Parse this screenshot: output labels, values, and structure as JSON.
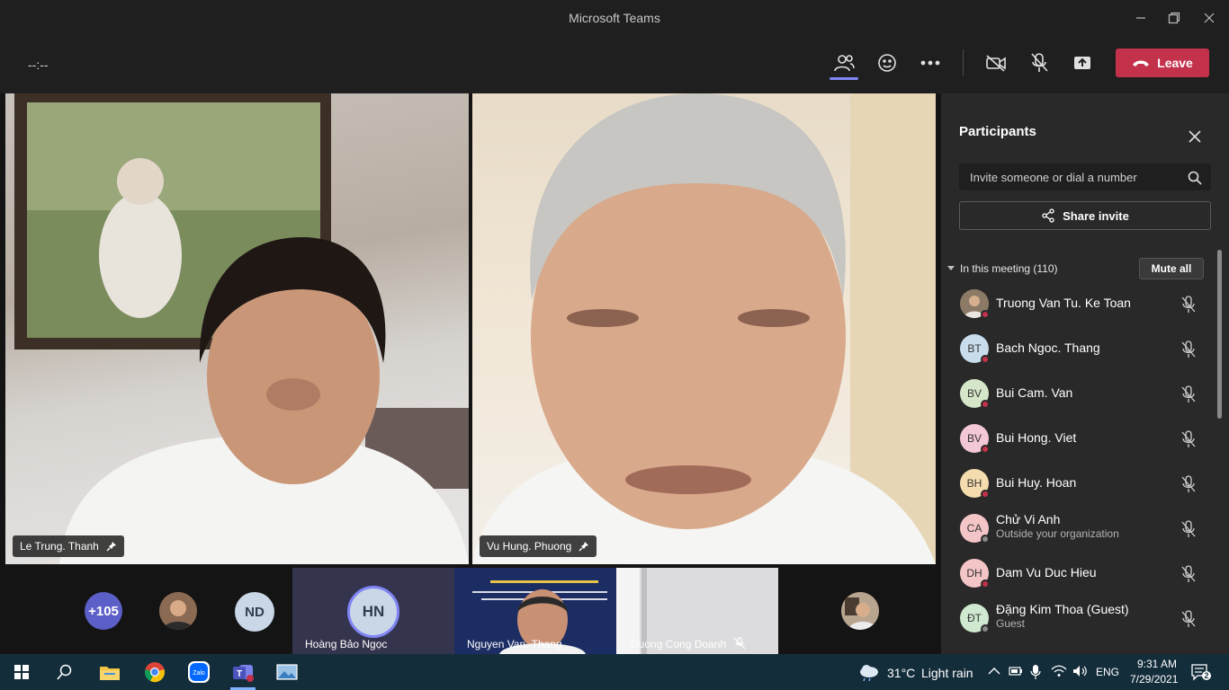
{
  "window": {
    "title": "Microsoft Teams"
  },
  "toolbar": {
    "timer": "--:--",
    "leave_label": "Leave"
  },
  "videos": [
    {
      "name": "Le Trung. Thanh"
    },
    {
      "name": "Vu Hung. Phuong"
    }
  ],
  "strip": {
    "overflow_count": "+105",
    "nd_initials": "ND",
    "tiles": [
      {
        "name": "Hoàng Bảo Ngọc",
        "initials": "HN"
      },
      {
        "name": "Nguyen Van. Thang"
      },
      {
        "name": "Duong Cong Doanh"
      }
    ]
  },
  "participants": {
    "title": "Participants",
    "invite_placeholder": "Invite someone or dial a number",
    "share_label": "Share invite",
    "section_label": "In this meeting (110)",
    "mute_all_label": "Mute all",
    "list": [
      {
        "name": "Truong Van Tu. Ke Toan",
        "initials": "",
        "color": "#6d5a4a",
        "sub": ""
      },
      {
        "name": "Bach Ngoc. Thang",
        "initials": "BT",
        "color": "#c9dceb",
        "sub": ""
      },
      {
        "name": "Bui Cam. Van",
        "initials": "BV",
        "color": "#d6e6c8",
        "sub": ""
      },
      {
        "name": "Bui Hong. Viet",
        "initials": "BV",
        "color": "#f2c7d6",
        "sub": ""
      },
      {
        "name": "Bui Huy. Hoan",
        "initials": "BH",
        "color": "#f5dcae",
        "sub": ""
      },
      {
        "name": "Chử Vi Anh",
        "initials": "CA",
        "color": "#f4c5c7",
        "sub": "Outside your organization"
      },
      {
        "name": "Dam Vu Duc Hieu",
        "initials": "DH",
        "color": "#f4c5c7",
        "sub": ""
      },
      {
        "name": "Đặng Kim Thoa (Guest)",
        "initials": "ĐT",
        "color": "#cfe8cf",
        "sub": "Guest"
      }
    ]
  },
  "taskbar": {
    "weather_temp": "31°C",
    "weather_desc": "Light rain",
    "language": "ENG",
    "time": "9:31 AM",
    "date": "7/29/2021",
    "notification_count": "2"
  },
  "colors": {
    "accent": "#7f85f5",
    "leave": "#c4314b",
    "panel": "#292929"
  }
}
